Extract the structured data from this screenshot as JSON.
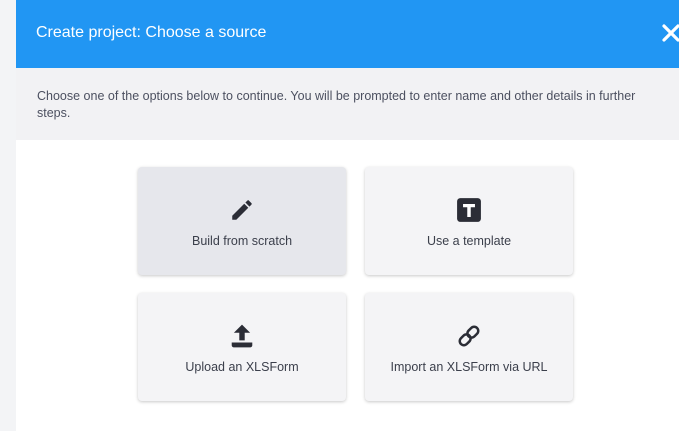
{
  "dialog": {
    "title": "Create project: Choose a source",
    "close_icon": "close-icon",
    "instructions": "Choose one of the options below to continue. You will be prompted to enter name and other details in further steps.",
    "header_color": "#2196f3"
  },
  "options": [
    {
      "label": "Build from scratch",
      "icon": "pencil-icon",
      "selected": true
    },
    {
      "label": "Use a template",
      "icon": "template-icon",
      "selected": false
    },
    {
      "label": "Upload an XLSForm",
      "icon": "upload-icon",
      "selected": false
    },
    {
      "label": "Import an XLSForm via URL",
      "icon": "link-icon",
      "selected": false
    }
  ]
}
